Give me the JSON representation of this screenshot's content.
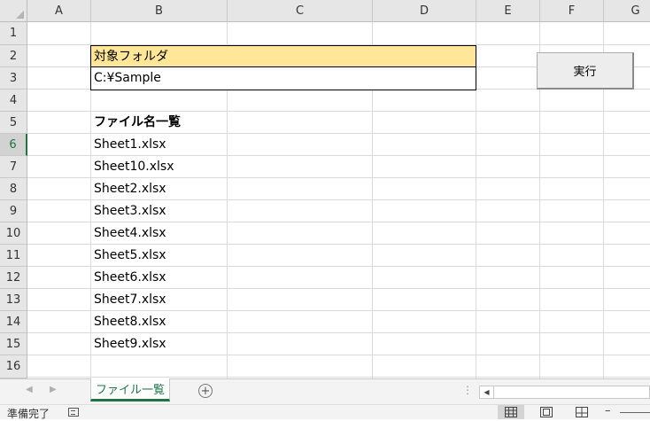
{
  "columns": [
    "A",
    "B",
    "C",
    "D",
    "E",
    "F",
    "G"
  ],
  "rows": [
    "1",
    "2",
    "3",
    "4",
    "5",
    "6",
    "7",
    "8",
    "9",
    "10",
    "11",
    "12",
    "13",
    "14",
    "15",
    "16"
  ],
  "active_row": "6",
  "cells": {
    "folder_label": "対象フォルダ",
    "folder_path": "C:¥Sample",
    "list_header": "ファイル名一覧",
    "files": [
      "Sheet1.xlsx",
      "Sheet10.xlsx",
      "Sheet2.xlsx",
      "Sheet3.xlsx",
      "Sheet4.xlsx",
      "Sheet5.xlsx",
      "Sheet6.xlsx",
      "Sheet7.xlsx",
      "Sheet8.xlsx",
      "Sheet9.xlsx"
    ]
  },
  "run_button": {
    "label": "実行"
  },
  "sheet_tabs": {
    "active": "ファイル一覧"
  },
  "status": {
    "ready": "準備完了"
  },
  "colors": {
    "header_fill": "#ffe699",
    "accent": "#217346"
  },
  "icons": [
    "sort-corner-icon",
    "tab-prev-icon",
    "tab-next-icon",
    "add-sheet-icon",
    "macro-record-icon",
    "normal-view-icon",
    "page-layout-icon",
    "page-break-icon"
  ]
}
